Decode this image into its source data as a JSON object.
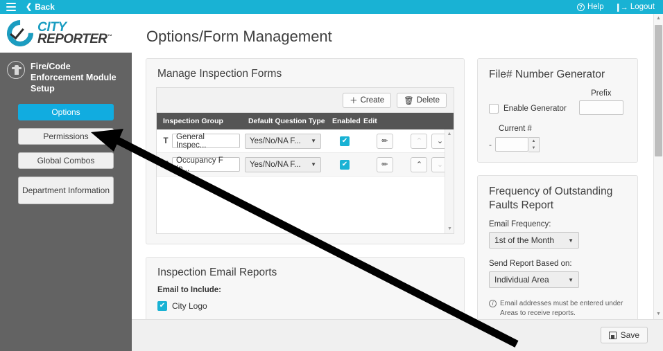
{
  "topbar": {
    "menu_icon": "hamburger-icon",
    "back_label": "Back",
    "back_icon": "chevron-left-icon",
    "help_label": "Help",
    "help_icon": "question-circle-icon",
    "logout_label": "Logout",
    "logout_icon": "sign-out-icon",
    "accent_color": "#19b2d4"
  },
  "brand": {
    "city": "CITY",
    "reporter": "REPORTER",
    "tm": "™",
    "logo_icon": "checkmark-circle-logo",
    "city_color": "#1b9dc1",
    "reporter_color": "#3b3b3b"
  },
  "sidebar": {
    "module_icon": "fire-hydrant-icon",
    "module_title": "Fire/Code Enforcement Module Setup",
    "background_color": "#636363",
    "items": [
      {
        "label": "Options",
        "active": true
      },
      {
        "label": "Permissions",
        "active": false
      },
      {
        "label": "Global Combos",
        "active": false
      },
      {
        "label": "Department Information",
        "active": false
      }
    ]
  },
  "main": {
    "page_title": "Options/Form Management",
    "forms_card": {
      "title": "Manage Inspection Forms",
      "create_label": "Create",
      "create_icon": "plus-icon",
      "delete_label": "Delete",
      "delete_icon": "trash-icon",
      "columns": [
        "Inspection Group",
        "Default Question Type",
        "Enabled",
        "Edit",
        "",
        ""
      ],
      "rows": [
        {
          "type_glyph": "T",
          "name": "General Inspec...",
          "question_type": "Yes/No/NA F...",
          "enabled": true,
          "edit_icon": "pencil-icon",
          "move_up_enabled": false,
          "move_down_enabled": true
        },
        {
          "type_glyph": "T",
          "name": "Occupancy F In...",
          "question_type": "Yes/No/NA F...",
          "enabled": true,
          "edit_icon": "pencil-icon",
          "move_up_enabled": true,
          "move_down_enabled": false
        }
      ]
    },
    "email_card": {
      "title": "Inspection Email Reports",
      "sub_label": "Email to Include:",
      "options": [
        {
          "label": "City Logo",
          "checked": true
        }
      ]
    }
  },
  "right": {
    "file_generator": {
      "title": "File# Number Generator",
      "enable_label": "Enable Generator",
      "enable_checked": false,
      "prefix_label": "Prefix",
      "prefix_value": "",
      "dash": "-",
      "current_label": "Current #",
      "current_value": ""
    },
    "faults_report": {
      "title": "Frequency of Outstanding Faults Report",
      "email_frequency_label": "Email Frequency:",
      "email_frequency_value": "1st of the Month",
      "send_report_label": "Send Report Based on:",
      "send_report_value": "Individual Area",
      "note_icon": "info-icon",
      "note": "Email addresses must be entered under Areas to receive reports."
    }
  },
  "footer": {
    "save_label": "Save",
    "save_icon": "floppy-disk-icon"
  },
  "scrollbar": {
    "up_arrow": "▲",
    "down_arrow": "▼"
  },
  "annotation": {
    "type": "arrow",
    "color": "#000000",
    "points_to": "sidebar-item-permissions"
  }
}
